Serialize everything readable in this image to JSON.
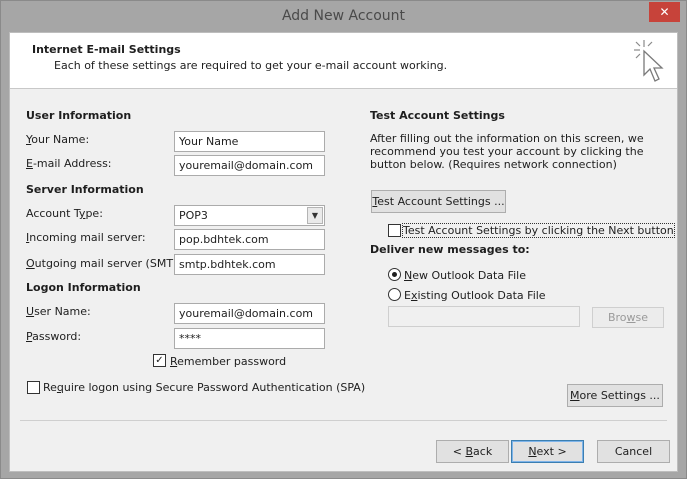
{
  "window": {
    "title": "Add New Account",
    "close_glyph": "✕"
  },
  "header": {
    "title": "Internet E-mail Settings",
    "subtitle": "Each of these settings are required to get your e-mail account working."
  },
  "user_info": {
    "section": "User Information",
    "name_label_u": "Y",
    "name_label": "our Name:",
    "name_value": "Your Name",
    "email_label_u": "E",
    "email_label": "-mail Address:",
    "email_value": "youremail@domain.com"
  },
  "server_info": {
    "section": "Server Information",
    "account_type_label_pre": "Account T",
    "account_type_label_u": "y",
    "account_type_label_post": "pe:",
    "account_type_value": "POP3",
    "incoming_label_u": "I",
    "incoming_label": "ncoming mail server:",
    "incoming_value": "pop.bdhtek.com",
    "outgoing_label_u": "O",
    "outgoing_label": "utgoing mail server (SMTP):",
    "outgoing_value": "smtp.bdhtek.com"
  },
  "logon_info": {
    "section": "Logon Information",
    "username_label_u": "U",
    "username_label": "ser Name:",
    "username_value": "youremail@domain.com",
    "password_label_u": "P",
    "password_label": "assword:",
    "password_value": "****",
    "remember_label_u": "R",
    "remember_label": "emember password",
    "remember_checked": "✓",
    "spa_label_pre": "Re",
    "spa_label_u": "q",
    "spa_label_post": "uire logon using Secure Password Authentication (SPA)"
  },
  "test_settings": {
    "section": "Test Account Settings",
    "description": "After filling out the information on this screen, we recommend you test your account by clicking the button below. (Requires network connection)",
    "button_u": "T",
    "button_label": "est Account Settings ...",
    "auto_test_label": "Test Account Settings by clicking the Next button"
  },
  "deliver": {
    "section": "Deliver new messages to:",
    "new_file_u": "N",
    "new_file": "ew Outlook Data File",
    "existing_file_pre": "E",
    "existing_file_u": "x",
    "existing_file_post": "isting Outlook Data File",
    "file_path_value": "",
    "browse_pre": "Bro",
    "browse_u": "w",
    "browse_post": "se"
  },
  "more_settings": {
    "u": "M",
    "label": "ore Settings ..."
  },
  "footer": {
    "back_pre": "< ",
    "back_u": "B",
    "back_post": "ack",
    "next_u": "N",
    "next_post": "ext >",
    "cancel": "Cancel"
  }
}
